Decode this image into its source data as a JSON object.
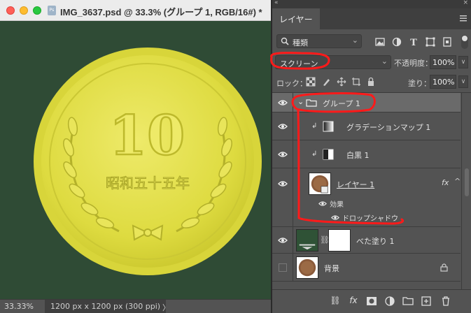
{
  "window": {
    "title": "IMG_3637.psd @ 33.3% (グループ 1, RGB/16#) *",
    "app_icon_text": "Ps"
  },
  "canvas": {
    "coin_number": "10",
    "coin_inscription": "昭和五十五年",
    "background_color": "#2f4b35",
    "coin_color": "#e3e14a"
  },
  "status": {
    "zoom": "33.33%",
    "doc_size": "1200 px x 1200 px (300 ppi)",
    "arrow": "〉"
  },
  "panel": {
    "tab_label": "レイヤー",
    "filter": {
      "label": "種類"
    },
    "blend_mode": "スクリーン",
    "opacity_label": "不透明度：",
    "opacity_value": "100%",
    "lock_label": "ロック：",
    "fill_label": "塗り：",
    "fill_value": "100%"
  },
  "layers": [
    {
      "name": "グループ 1",
      "kind": "group",
      "visible": true,
      "selected": true
    },
    {
      "name": "グラデーションマップ 1",
      "kind": "adjustment",
      "visible": true
    },
    {
      "name": "白黒 1",
      "kind": "adjustment",
      "visible": true
    },
    {
      "name": "レイヤー 1",
      "kind": "pixel",
      "visible": true,
      "fx": "fx"
    },
    {
      "name": "効果",
      "kind": "effects"
    },
    {
      "name": "ドロップシャドウ",
      "kind": "effect"
    },
    {
      "name": "べた塗り 1",
      "kind": "fill",
      "visible": true
    },
    {
      "name": "背景",
      "kind": "background",
      "visible": false,
      "locked": true
    }
  ],
  "colors": {
    "annotation": "#ff1a1a",
    "panel_bg": "#535353",
    "selected_row": "#6a6a6a"
  }
}
